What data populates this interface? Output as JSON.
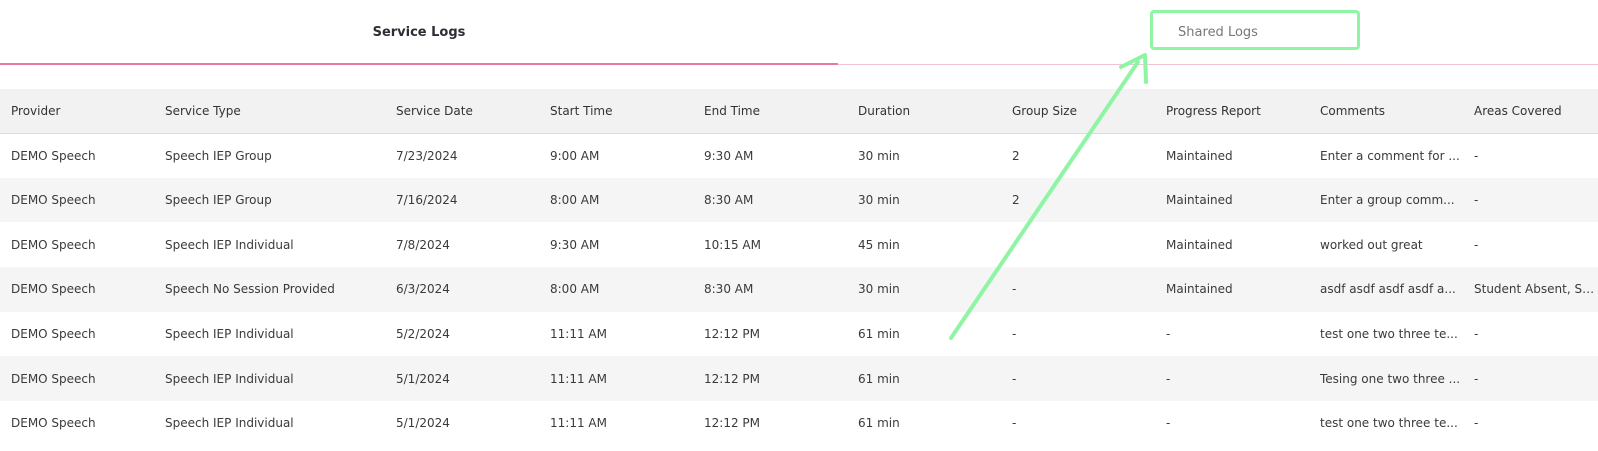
{
  "tabs": [
    {
      "label": "Service Logs",
      "active": true
    },
    {
      "label": "Shared Logs",
      "active": false
    }
  ],
  "colors": {
    "active_underline": "#e8799a",
    "highlight": "#8ef5a4"
  },
  "table": {
    "columns": [
      "Provider",
      "Service Type",
      "Service Date",
      "Start Time",
      "End Time",
      "Duration",
      "Group Size",
      "Progress Report",
      "Comments",
      "Areas Covered"
    ],
    "rows": [
      [
        "DEMO Speech",
        "Speech IEP Group",
        "7/23/2024",
        "9:00 AM",
        "9:30 AM",
        "30 min",
        "2",
        "Maintained",
        "Enter a comment for ...",
        "-"
      ],
      [
        "DEMO Speech",
        "Speech IEP Group",
        "7/16/2024",
        "8:00 AM",
        "8:30 AM",
        "30 min",
        "2",
        "Maintained",
        "Enter a group comm...",
        "-"
      ],
      [
        "DEMO Speech",
        "Speech IEP Individual",
        "7/8/2024",
        "9:30 AM",
        "10:15 AM",
        "45 min",
        "-",
        "Maintained",
        "worked out great",
        "-"
      ],
      [
        "DEMO Speech",
        "Speech No Session Provided",
        "6/3/2024",
        "8:00 AM",
        "8:30 AM",
        "30 min",
        "-",
        "Maintained",
        "asdf asdf asdf asdf a...",
        "Student Absent, Stud..."
      ],
      [
        "DEMO Speech",
        "Speech IEP Individual",
        "5/2/2024",
        "11:11 AM",
        "12:12 PM",
        "61 min",
        "-",
        "-",
        "test one two three te...",
        "-"
      ],
      [
        "DEMO Speech",
        "Speech IEP Individual",
        "5/1/2024",
        "11:11 AM",
        "12:12 PM",
        "61 min",
        "-",
        "-",
        "Tesing one two three ...",
        "-"
      ],
      [
        "DEMO Speech",
        "Speech IEP Individual",
        "5/1/2024",
        "11:11 AM",
        "12:12 PM",
        "61 min",
        "-",
        "-",
        "test one two three te...",
        "-"
      ]
    ]
  }
}
